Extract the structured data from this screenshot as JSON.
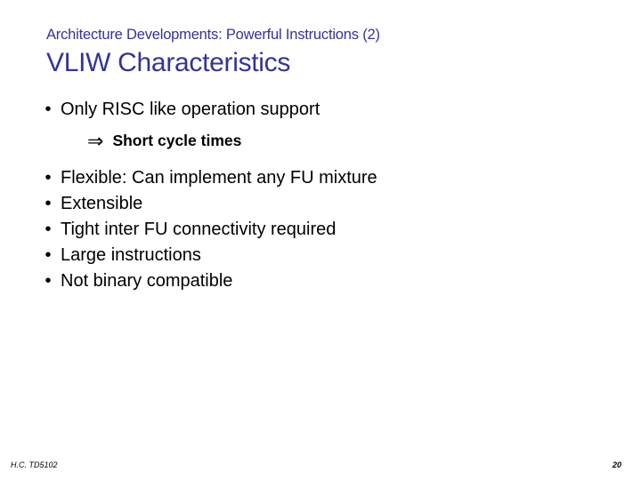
{
  "header": {
    "subtitle": "Architecture Developments: Powerful Instructions (2)",
    "title": "VLIW Characteristics"
  },
  "bullets": [
    {
      "text": "Only RISC like operation support",
      "sub": "Short cycle times"
    },
    {
      "text": "Flexible: Can implement any FU mixture"
    },
    {
      "text": "Extensible"
    },
    {
      "text": "Tight inter FU connectivity required"
    },
    {
      "text": "Large instructions"
    },
    {
      "text": "Not binary compatible"
    }
  ],
  "footer": {
    "left": "H.C.  TD5102",
    "right": "20"
  },
  "glyph": {
    "bullet": "•",
    "arrow": "⇒"
  }
}
